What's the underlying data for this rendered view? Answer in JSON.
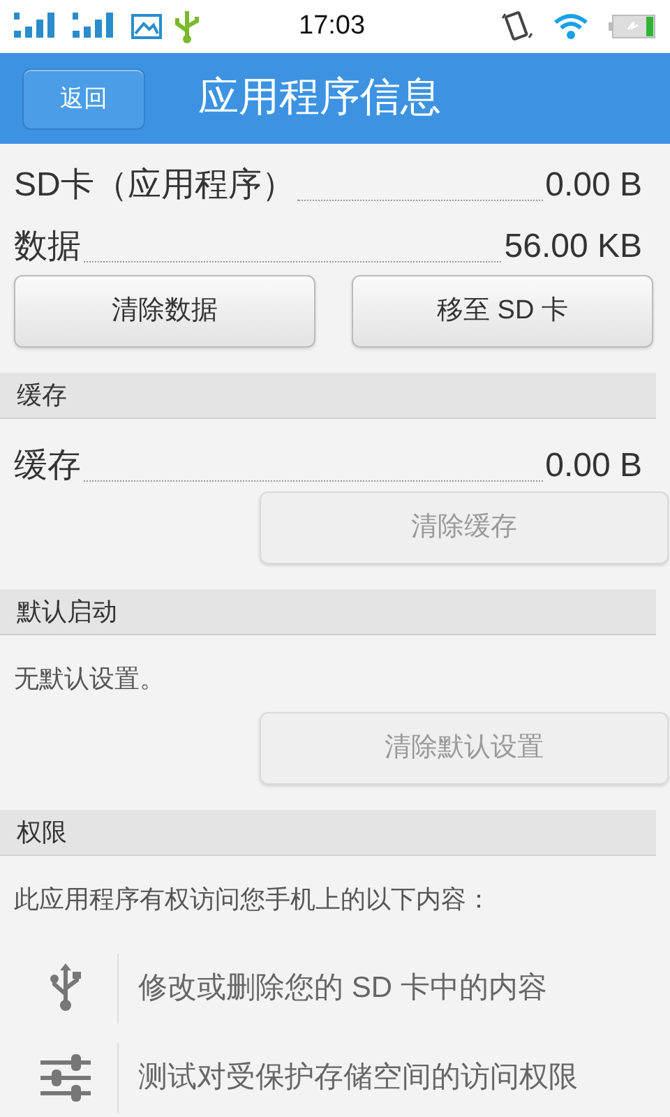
{
  "status_bar": {
    "time": "17:03"
  },
  "header": {
    "back": "返回",
    "title": "应用程序信息"
  },
  "sections": [
    {
      "items": [
        {
          "kind": "row",
          "label": "SD卡（应用程序）",
          "value": "0.00 B"
        },
        {
          "kind": "row",
          "label": "数据",
          "value": "56.00 KB"
        }
      ],
      "buttons": [
        {
          "label": "清除数据",
          "disabled": false
        },
        {
          "label": "移至 SD 卡",
          "disabled": false
        }
      ]
    },
    {
      "title": "缓存",
      "items": [
        {
          "kind": "row",
          "label": "缓存",
          "value": "0.00 B"
        }
      ],
      "buttons": [
        {
          "label": "清除缓存",
          "disabled": true
        }
      ]
    },
    {
      "title": "默认启动",
      "items": [
        {
          "kind": "note",
          "text": "无默认设置。"
        }
      ],
      "buttons": [
        {
          "label": "清除默认设置",
          "disabled": true
        }
      ]
    },
    {
      "title": "权限",
      "items": [
        {
          "kind": "note",
          "text": "此应用程序有权访问您手机上的以下内容："
        },
        {
          "kind": "permission",
          "text": "修改或删除您的 SD 卡中的内容"
        },
        {
          "kind": "permission",
          "text": "测试对受保护存储空间的访问权限"
        }
      ]
    }
  ]
}
